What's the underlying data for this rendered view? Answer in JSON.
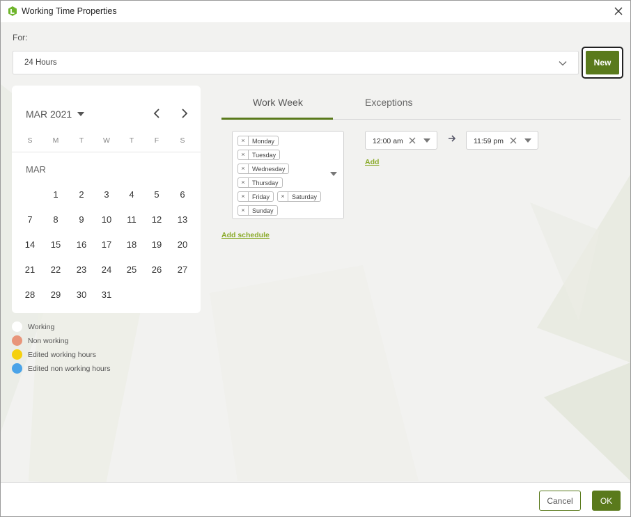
{
  "window": {
    "title": "Working Time Properties",
    "close_icon": "close-icon",
    "app_icon": "app-logo-icon"
  },
  "for_section": {
    "label": "For:",
    "selected": "24 Hours"
  },
  "new_button": {
    "label": "New"
  },
  "calendar": {
    "month_year": "MAR 2021",
    "weekdays": [
      "S",
      "M",
      "T",
      "W",
      "T",
      "F",
      "S"
    ],
    "sub_month": "MAR",
    "weeks": [
      [
        "",
        "1",
        "2",
        "3",
        "4",
        "5",
        "6"
      ],
      [
        "7",
        "8",
        "9",
        "10",
        "11",
        "12",
        "13"
      ],
      [
        "14",
        "15",
        "16",
        "17",
        "18",
        "19",
        "20"
      ],
      [
        "21",
        "22",
        "23",
        "24",
        "25",
        "26",
        "27"
      ],
      [
        "28",
        "29",
        "30",
        "31",
        "",
        "",
        ""
      ]
    ]
  },
  "legend": [
    {
      "label": "Working",
      "color": "#ffffff"
    },
    {
      "label": "Non working",
      "color": "#e8957a"
    },
    {
      "label": "Edited working hours",
      "color": "#f5d00e"
    },
    {
      "label": "Edited non working hours",
      "color": "#4aa3e8"
    }
  ],
  "tabs": [
    {
      "label": "Work Week",
      "active": true
    },
    {
      "label": "Exceptions",
      "active": false
    }
  ],
  "schedule": {
    "days": [
      "Monday",
      "Tuesday",
      "Wednesday",
      "Thursday",
      "Friday",
      "Saturday",
      "Sunday"
    ],
    "chip_remove_glyph": "×",
    "start_time": "12:00 am",
    "end_time": "11:59 pm",
    "add_link": "Add",
    "add_schedule_link": "Add schedule"
  },
  "footer": {
    "cancel_label": "Cancel",
    "ok_label": "OK"
  },
  "colors": {
    "accent": "#5a7a1c",
    "link": "#8aaa2a"
  }
}
